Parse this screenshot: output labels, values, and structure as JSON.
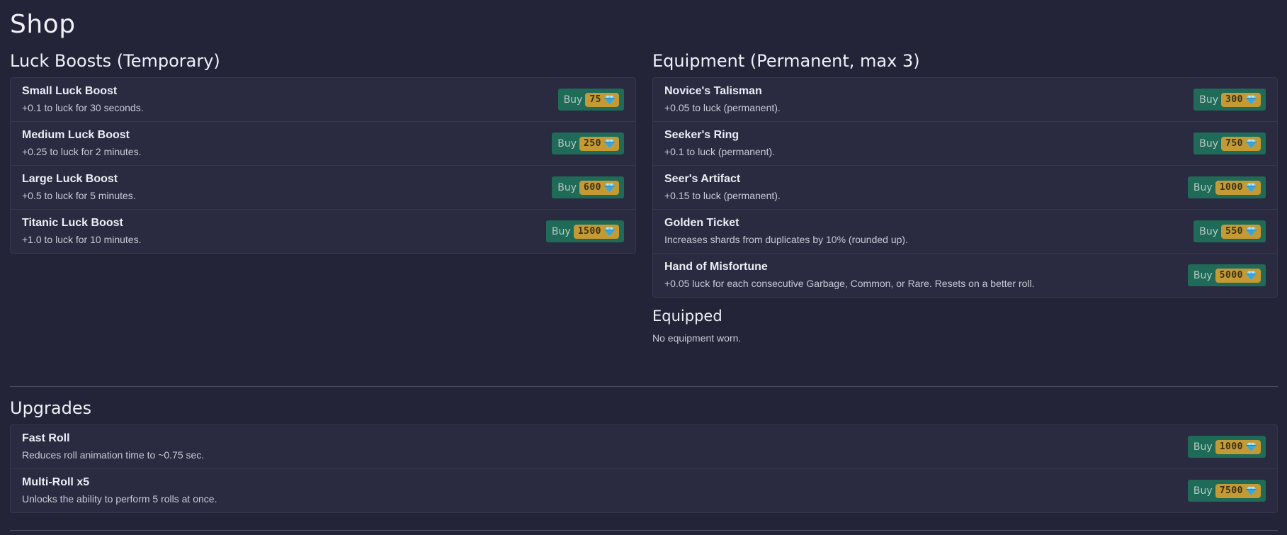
{
  "page": {
    "title": "Shop"
  },
  "colors": {
    "background": "#232438",
    "panel": "#2a2b40",
    "buy_button": "#1f6b58",
    "price_pill": "#c49a34"
  },
  "luck_boosts": {
    "title": "Luck Boosts (Temporary)",
    "items": [
      {
        "name": "Small Luck Boost",
        "desc": "+0.1 to luck for 30 seconds.",
        "buy": "Buy",
        "price": "75",
        "icon": "diamond-icon"
      },
      {
        "name": "Medium Luck Boost",
        "desc": "+0.25 to luck for 2 minutes.",
        "buy": "Buy",
        "price": "250",
        "icon": "diamond-icon"
      },
      {
        "name": "Large Luck Boost",
        "desc": "+0.5 to luck for 5 minutes.",
        "buy": "Buy",
        "price": "600",
        "icon": "diamond-icon"
      },
      {
        "name": "Titanic Luck Boost",
        "desc": "+1.0 to luck for 10 minutes.",
        "buy": "Buy",
        "price": "1500",
        "icon": "diamond-icon"
      }
    ]
  },
  "equipment": {
    "title": "Equipment (Permanent, max 3)",
    "items": [
      {
        "name": "Novice's Talisman",
        "desc": "+0.05 to luck (permanent).",
        "buy": "Buy",
        "price": "300",
        "icon": "diamond-icon"
      },
      {
        "name": "Seeker's Ring",
        "desc": "+0.1 to luck (permanent).",
        "buy": "Buy",
        "price": "750",
        "icon": "diamond-icon"
      },
      {
        "name": "Seer's Artifact",
        "desc": "+0.15 to luck (permanent).",
        "buy": "Buy",
        "price": "1000",
        "icon": "diamond-icon"
      },
      {
        "name": "Golden Ticket",
        "desc": "Increases shards from duplicates by 10% (rounded up).",
        "buy": "Buy",
        "price": "550",
        "icon": "diamond-icon"
      },
      {
        "name": "Hand of Misfortune",
        "desc": "+0.05 luck for each consecutive Garbage, Common, or Rare. Resets on a better roll.",
        "buy": "Buy",
        "price": "5000",
        "icon": "diamond-icon"
      }
    ]
  },
  "equipped": {
    "title": "Equipped",
    "text": "No equipment worn."
  },
  "upgrades": {
    "title": "Upgrades",
    "items": [
      {
        "name": "Fast Roll",
        "desc": "Reduces roll animation time to ~0.75 sec.",
        "buy": "Buy",
        "price": "1000",
        "icon": "diamond-icon"
      },
      {
        "name": "Multi-Roll x5",
        "desc": "Unlocks the ability to perform 5 rolls at once.",
        "buy": "Buy",
        "price": "7500",
        "icon": "diamond-icon"
      }
    ]
  }
}
